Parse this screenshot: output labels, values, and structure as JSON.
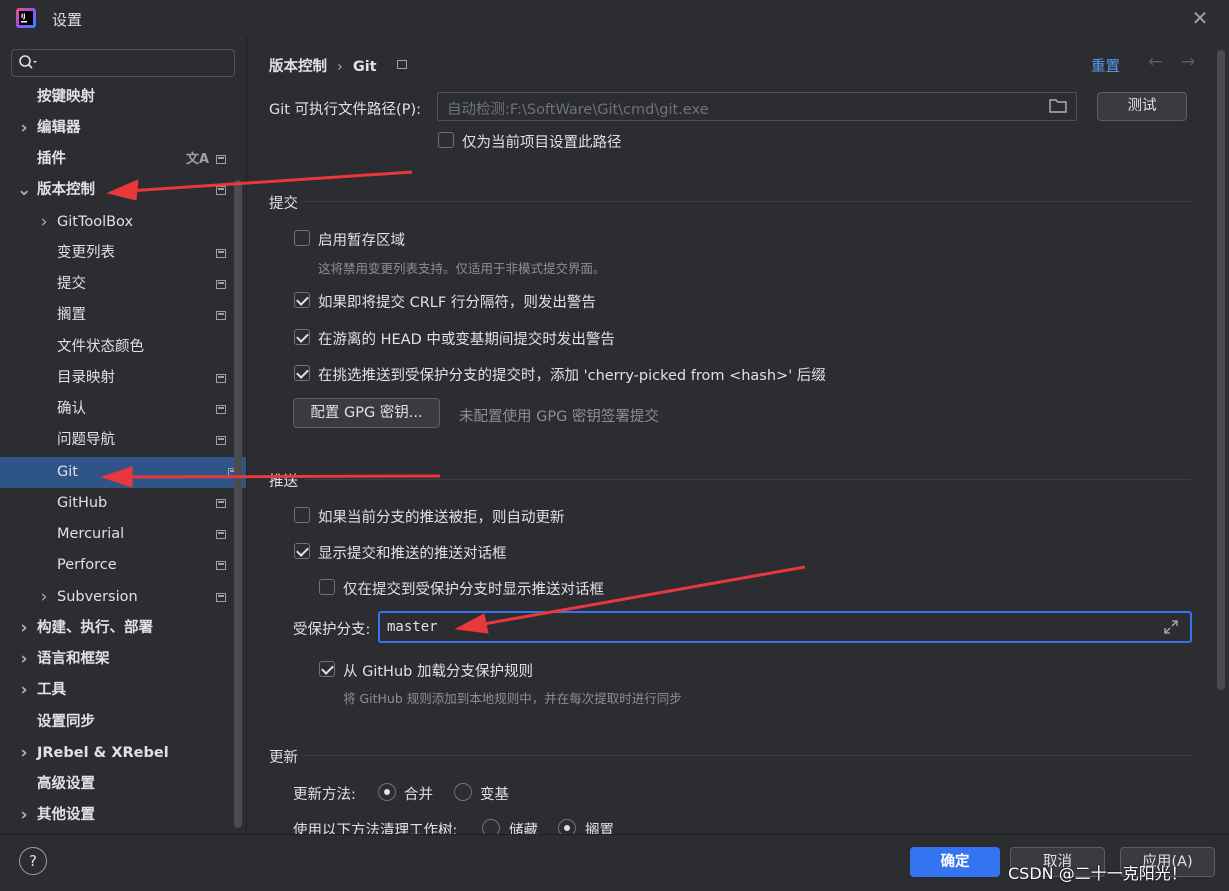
{
  "window": {
    "title": "设置"
  },
  "search": {
    "placeholder": ""
  },
  "sidebar": {
    "items": [
      {
        "label": "按键映射",
        "bold": true
      },
      {
        "label": "编辑器",
        "bold": true
      },
      {
        "label": "插件",
        "bold": true
      },
      {
        "label": "版本控制",
        "bold": true
      },
      {
        "label": "GitToolBox"
      },
      {
        "label": "变更列表"
      },
      {
        "label": "提交"
      },
      {
        "label": "搁置"
      },
      {
        "label": "文件状态颜色"
      },
      {
        "label": "目录映射"
      },
      {
        "label": "确认"
      },
      {
        "label": "问题导航"
      },
      {
        "label": "Git",
        "selected": true
      },
      {
        "label": "GitHub"
      },
      {
        "label": "Mercurial"
      },
      {
        "label": "Perforce"
      },
      {
        "label": "Subversion"
      },
      {
        "label": "构建、执行、部署",
        "bold": true
      },
      {
        "label": "语言和框架",
        "bold": true
      },
      {
        "label": "工具",
        "bold": true
      },
      {
        "label": "设置同步",
        "bold": true
      },
      {
        "label": "JRebel & XRebel",
        "bold": true
      },
      {
        "label": "高级设置",
        "bold": true
      },
      {
        "label": "其他设置",
        "bold": true
      }
    ]
  },
  "breadcrumb": {
    "parent": "版本控制",
    "separator": "›",
    "current": "Git"
  },
  "header": {
    "reset": "重置"
  },
  "git_path": {
    "label": "Git 可执行文件路径(P):",
    "placeholder": "自动检测:F:\\SoftWare\\Git\\cmd\\git.exe",
    "test_button": "测试",
    "project_only": "仅为当前项目设置此路径"
  },
  "commit": {
    "title": "提交",
    "staging_area": "启用暂存区域",
    "staging_hint": "这将禁用变更列表支持。仅适用于非模式提交界面。",
    "crlf_warn": "如果即将提交 CRLF 行分隔符，则发出警告",
    "detached_head": "在游离的 HEAD 中或变基期间提交时发出警告",
    "cherry_pick": "在挑选推送到受保护分支的提交时，添加 'cherry-picked from <hash>' 后缀",
    "gpg_button": "配置 GPG 密钥...",
    "gpg_hint": "未配置使用 GPG 密钥签署提交"
  },
  "push": {
    "title": "推送",
    "auto_update": "如果当前分支的推送被拒，则自动更新",
    "show_dialog": "显示提交和推送的推送对话框",
    "protected_only": "仅在提交到受保护分支时显示推送对话框",
    "protected_label": "受保护分支:",
    "protected_value": "master",
    "github_rules": "从 GitHub 加载分支保护规则",
    "github_hint": "将 GitHub 规则添加到本地规则中，并在每次提取时进行同步"
  },
  "update": {
    "title": "更新",
    "method_label": "更新方法:",
    "merge": "合并",
    "rebase": "变基",
    "clean_label": "使用以下方法清理工作树:",
    "stash": "储藏",
    "shelve": "搁置"
  },
  "footer": {
    "help": "?",
    "ok": "确定",
    "cancel": "取消",
    "apply": "应用(A)"
  },
  "watermark": "CSDN @二十一克阳光！",
  "colors": {
    "accent": "#3574f0",
    "selection": "#2f5487",
    "annotation_arrow": "#e8383b",
    "link": "#589df6"
  }
}
